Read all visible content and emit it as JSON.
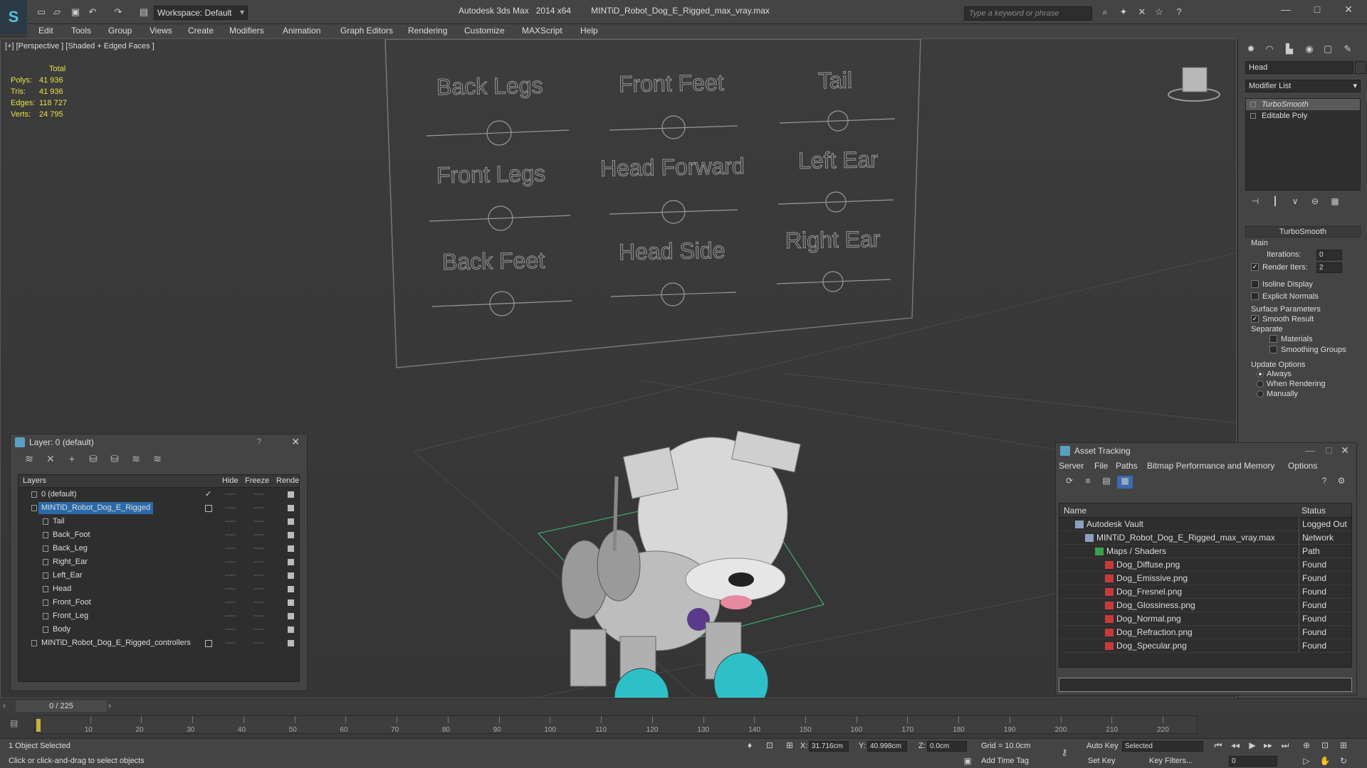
{
  "titlebar": {
    "workspace": "Workspace: Default",
    "app_name": "Autodesk 3ds Max",
    "version": "2014 x64",
    "file_name": "MINTiD_Robot_Dog_E_Rigged_max_vray.max",
    "search_placeholder": "Type a keyword or phrase"
  },
  "menu": [
    "Edit",
    "Tools",
    "Group",
    "Views",
    "Create",
    "Modifiers",
    "Animation",
    "Graph Editors",
    "Rendering",
    "Customize",
    "MAXScript",
    "Help"
  ],
  "viewport": {
    "label": "[+] [Perspective ] [Shaded + Edged Faces ]",
    "stats": {
      "total_label": "Total",
      "rows": [
        {
          "label": "Polys:",
          "value": "41 936"
        },
        {
          "label": "Tris:",
          "value": "41 936"
        },
        {
          "label": "Edges:",
          "value": "118 727"
        },
        {
          "label": "Verts:",
          "value": "24 795"
        }
      ]
    },
    "controllers": [
      "Back Legs",
      "Front Feet",
      "Tail",
      "Front Legs",
      "Head Forward",
      "Left Ear",
      "Back Feet",
      "Head Side",
      "Right Ear"
    ]
  },
  "command_panel": {
    "object_name": "Head",
    "modifier_list": "Modifier List",
    "stack": [
      "TurboSmooth",
      "Editable Poly"
    ],
    "rollout_title": "TurboSmooth",
    "main_label": "Main",
    "iterations_label": "Iterations:",
    "iterations_value": "0",
    "render_iters_label": "Render Iters:",
    "render_iters_value": "2",
    "isoline_label": "Isoline Display",
    "explicit_normals_label": "Explicit Normals",
    "surface_params_label": "Surface Parameters",
    "smooth_result_label": "Smooth Result",
    "separate_label": "Separate",
    "materials_label": "Materials",
    "smoothing_groups_label": "Smoothing Groups",
    "update_options_label": "Update Options",
    "always_label": "Always",
    "when_rendering_label": "When Rendering",
    "manually_label": "Manually"
  },
  "layer_panel": {
    "title": "Layer: 0 (default)",
    "help": "?",
    "columns": [
      "Layers",
      "Hide",
      "Freeze",
      "Rende"
    ],
    "rows": [
      {
        "name": "0 (default)",
        "indent": 0
      },
      {
        "name": "MINTiD_Robot_Dog_E_Rigged",
        "indent": 0
      },
      {
        "name": "Tail",
        "indent": 1
      },
      {
        "name": "Back_Foot",
        "indent": 1
      },
      {
        "name": "Back_Leg",
        "indent": 1
      },
      {
        "name": "Right_Ear",
        "indent": 1
      },
      {
        "name": "Left_Ear",
        "indent": 1
      },
      {
        "name": "Head",
        "indent": 1
      },
      {
        "name": "Front_Foot",
        "indent": 1
      },
      {
        "name": "Front_Leg",
        "indent": 1
      },
      {
        "name": "Body",
        "indent": 1
      },
      {
        "name": "MINTiD_Robot_Dog_E_Rigged_controllers",
        "indent": 0
      }
    ],
    "dash": "----"
  },
  "asset_panel": {
    "title": "Asset Tracking",
    "menu": [
      "Server",
      "File",
      "Paths",
      "Bitmap Performance and Memory",
      "Options"
    ],
    "columns": [
      "Name",
      "Status"
    ],
    "rows": [
      {
        "name": "Autodesk Vault",
        "status": "Logged Out ...",
        "indent": 1
      },
      {
        "name": "MINTiD_Robot_Dog_E_Rigged_max_vray.max",
        "status": "Network Path",
        "indent": 2
      },
      {
        "name": "Maps / Shaders",
        "status": "",
        "indent": 3
      },
      {
        "name": "Dog_Diffuse.png",
        "status": "Found",
        "indent": 4
      },
      {
        "name": "Dog_Emissive.png",
        "status": "Found",
        "indent": 4
      },
      {
        "name": "Dog_Fresnel.png",
        "status": "Found",
        "indent": 4
      },
      {
        "name": "Dog_Glossiness.png",
        "status": "Found",
        "indent": 4
      },
      {
        "name": "Dog_Normal.png",
        "status": "Found",
        "indent": 4
      },
      {
        "name": "Dog_Refraction.png",
        "status": "Found",
        "indent": 4
      },
      {
        "name": "Dog_Specular.png",
        "status": "Found",
        "indent": 4
      }
    ]
  },
  "timeline": {
    "position": "0 / 225",
    "ticks": [
      "10",
      "20",
      "30",
      "40",
      "50",
      "60",
      "70",
      "80",
      "90",
      "100",
      "110",
      "120",
      "130",
      "140",
      "150",
      "160",
      "170",
      "180",
      "190",
      "200",
      "210",
      "220"
    ]
  },
  "status": {
    "selection": "1 Object Selected",
    "prompt": "Click or click-and-drag to select objects",
    "x_label": "X:",
    "x_value": "31.716cm",
    "y_label": "Y:",
    "y_value": "40.998cm",
    "z_label": "Z:",
    "z_value": "0.0cm",
    "grid": "Grid = 10.0cm",
    "add_time_tag": "Add Time Tag",
    "auto_key": "Auto Key",
    "set_key": "Set Key",
    "selected_option": "Selected",
    "key_filters": "Key Filters...",
    "frame": "0"
  }
}
